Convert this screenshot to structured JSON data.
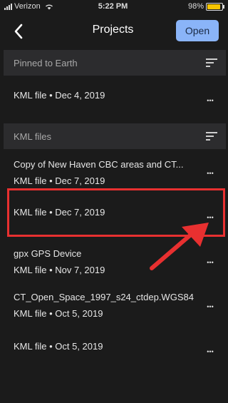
{
  "status_bar": {
    "carrier": "Verizon",
    "time": "5:22 PM",
    "battery_percent": "98%",
    "battery_level": 0.98
  },
  "nav": {
    "title": "Projects",
    "open_label": "Open",
    "back_icon": "chevron-left-icon"
  },
  "sections": {
    "pinned": {
      "title": "Pinned to Earth",
      "sort_icon": "sort-icon",
      "items": [
        {
          "title": "",
          "subtitle": "KML file • Dec 4, 2019"
        }
      ]
    },
    "kml": {
      "title": "KML files",
      "sort_icon": "sort-icon",
      "items": [
        {
          "title": "Copy of New Haven CBC areas and CT...",
          "subtitle": "KML file • Dec 7, 2019"
        },
        {
          "title": "",
          "subtitle": "KML file • Dec 7, 2019"
        },
        {
          "title": "gpx GPS Device",
          "subtitle": "KML file • Nov 7, 2019"
        },
        {
          "title": "CT_Open_Space_1997_s24_ctdep.WGS84",
          "subtitle": "KML file • Oct 5, 2019"
        },
        {
          "title": "",
          "subtitle": "KML file • Oct 5, 2019"
        }
      ]
    }
  },
  "more_label": "•••",
  "colors": {
    "background": "#1b1b1b",
    "section_header": "#2c2c2e",
    "accent": "#8ab4f8",
    "annotation": "#e83030"
  }
}
